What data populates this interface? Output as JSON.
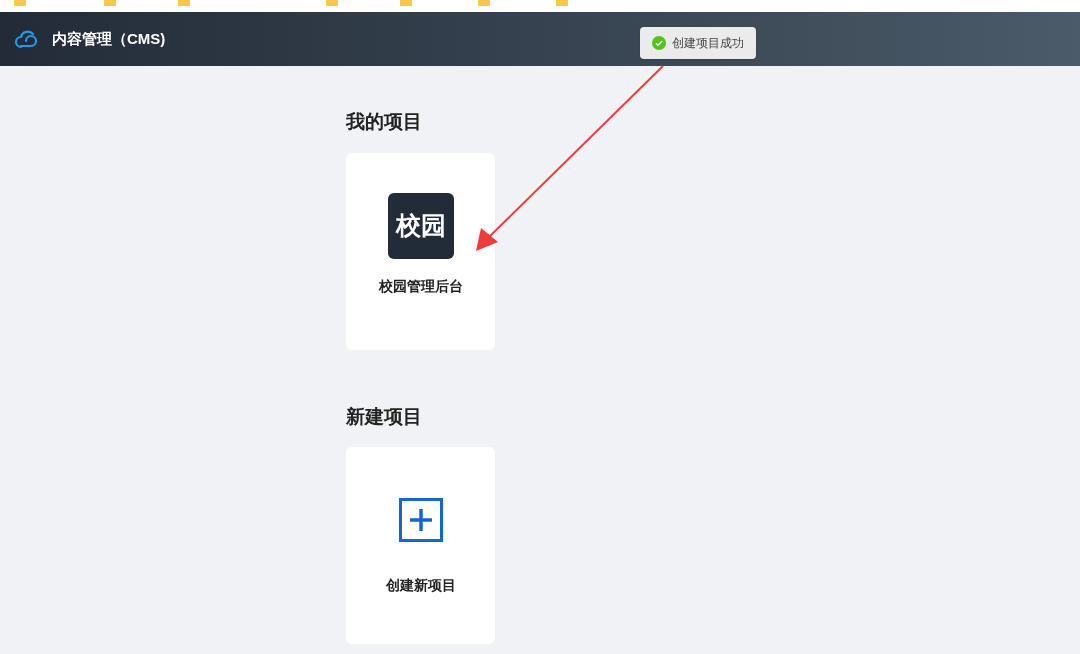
{
  "header": {
    "title": "内容管理（CMS)"
  },
  "toast": {
    "message": "创建项目成功"
  },
  "sections": [
    {
      "title": "我的项目",
      "cards": [
        {
          "kind": "project",
          "logo_text": "校园",
          "label": "校园管理后台"
        }
      ]
    },
    {
      "title": "新建项目",
      "cards": [
        {
          "kind": "create",
          "label": "创建新项目"
        }
      ]
    }
  ]
}
